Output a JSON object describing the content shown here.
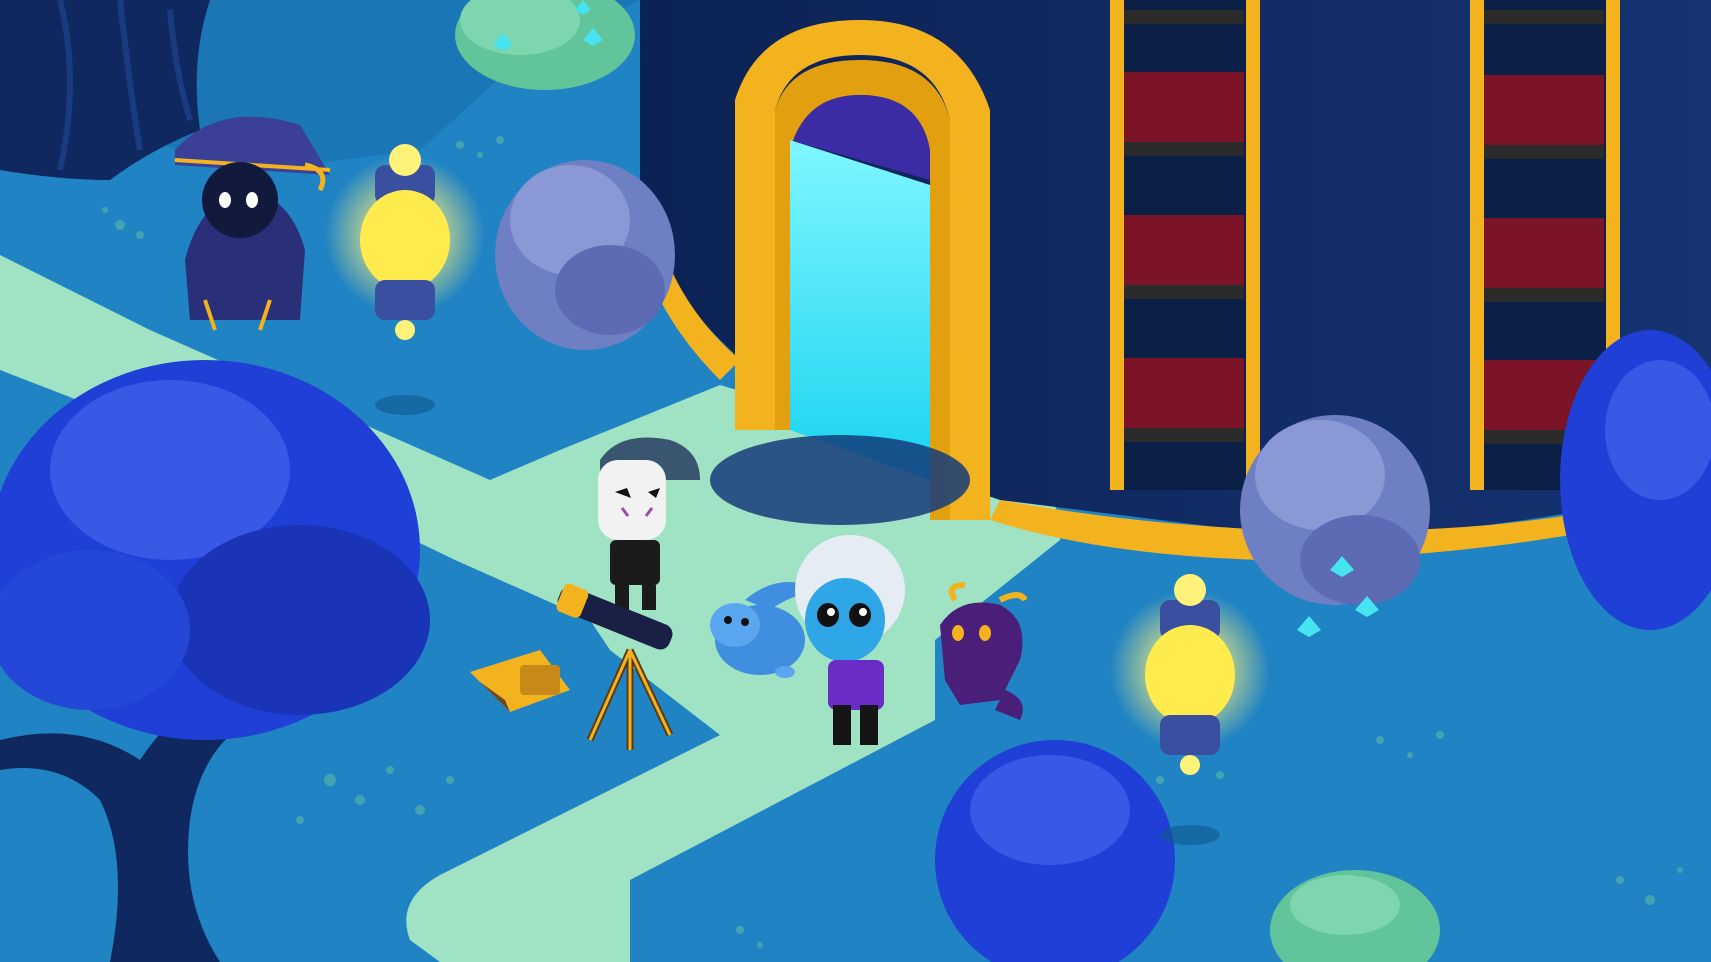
{
  "game": {
    "scene_name": "",
    "palette": {
      "ground": "#1f83c4",
      "ground_shadow": "#176aa6",
      "path": "#9fe3c4",
      "building": "#0f2a5e",
      "gold": "#f2b31e",
      "portal": "#2fe6f2",
      "lamp_glow": "#fff27a",
      "tree_leaf": "#1f3fd6",
      "bush_pale": "#7b8fce",
      "bush_green": "#62c49a",
      "book_red": "#7a1426"
    },
    "entities": [
      {
        "name": "wizard-npc",
        "kind": "npc"
      },
      {
        "name": "masked-player",
        "kind": "player"
      },
      {
        "name": "white-hair-player",
        "kind": "player"
      },
      {
        "name": "blue-bunny-pet",
        "kind": "pet"
      },
      {
        "name": "purple-dragon-pet",
        "kind": "pet"
      },
      {
        "name": "telescope",
        "kind": "object"
      },
      {
        "name": "open-chest",
        "kind": "object"
      },
      {
        "name": "glowing-lamp-left",
        "kind": "object"
      },
      {
        "name": "glowing-lamp-right",
        "kind": "object"
      },
      {
        "name": "library-portal-door",
        "kind": "door"
      },
      {
        "name": "fireflies",
        "kind": "ambient"
      }
    ]
  }
}
